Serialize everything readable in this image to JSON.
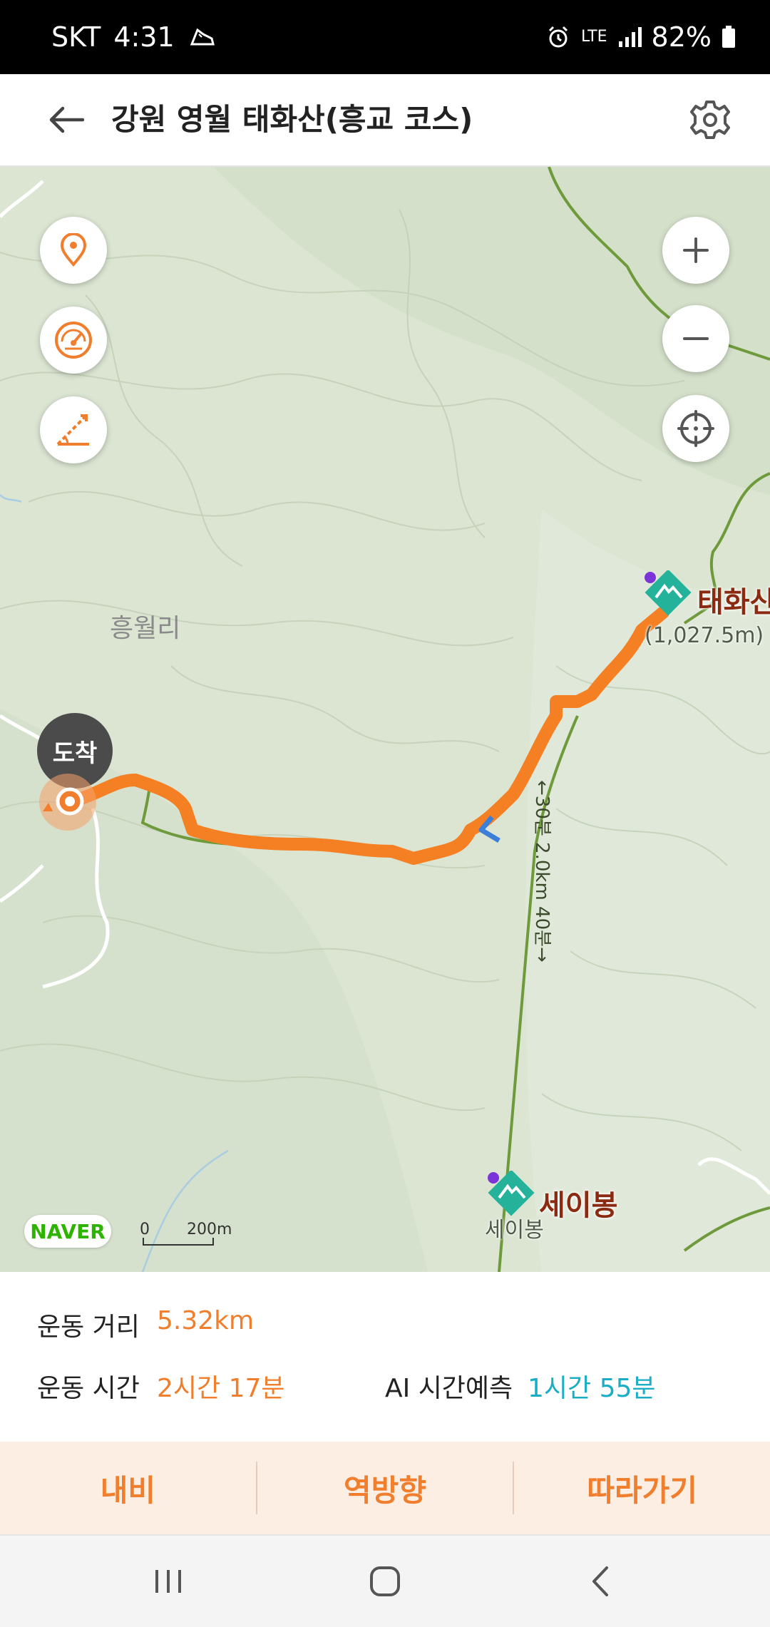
{
  "status_bar": {
    "carrier": "SKT",
    "time": "4:31",
    "network": "LTE",
    "battery": "82%",
    "icons": [
      "sneaker-icon",
      "alarm-icon",
      "lte-icon",
      "signal-icon",
      "battery-icon"
    ]
  },
  "header": {
    "title": "강원 영월 태화산(흥교 코스)",
    "back_icon": "arrow-left-icon",
    "settings_icon": "gear-icon"
  },
  "map": {
    "place_label": "흥월리",
    "arrival_badge": "도착",
    "peaks": [
      {
        "name": "태화산",
        "subtitle": "(1,027.5m)",
        "overlay": "태화산"
      },
      {
        "name": "세이봉",
        "subtitle": "세이봉"
      }
    ],
    "trail_label": "←30분 2.0km 40분→",
    "scale": {
      "left": "0",
      "right": "200m"
    },
    "provider": "NAVER",
    "left_buttons": [
      "location-pin-icon",
      "speedometer-icon",
      "slope-icon"
    ],
    "right_buttons": [
      "zoom-in-icon",
      "zoom-out-icon",
      "crosshair-icon"
    ],
    "route_color": "#f58024",
    "trail_color": "#6e9a3c"
  },
  "stats": {
    "distance_label": "운동 거리",
    "distance_value": "5.32km",
    "time_label": "운동 시간",
    "time_value": "2시간 17분",
    "ai_label": "AI 시간예측",
    "ai_value": "1시간 55분"
  },
  "actions": {
    "navigate": "내비",
    "reverse": "역방향",
    "follow": "따라가기"
  },
  "nav_bar": {
    "icons": [
      "recent-apps-icon",
      "home-icon",
      "back-icon"
    ]
  },
  "colors": {
    "accent": "#f07e2c",
    "ai_value": "#1aaec6",
    "action_bar_bg": "#fdeee3",
    "map_bg": "#dde6d4"
  }
}
